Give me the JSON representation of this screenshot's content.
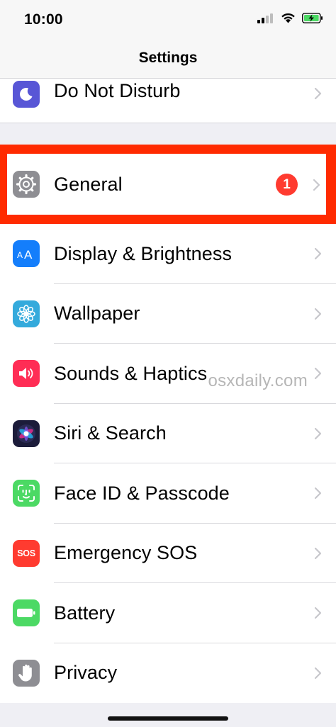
{
  "status": {
    "time": "10:00"
  },
  "nav": {
    "title": "Settings"
  },
  "rows": {
    "dnd": {
      "label": "Do Not Disturb",
      "icon": "moon-icon",
      "color": "#5856d6"
    },
    "general": {
      "label": "General",
      "icon": "gear-icon",
      "color": "#8e8e93",
      "badge": "1"
    },
    "display": {
      "label": "Display & Brightness",
      "icon": "text-size-icon",
      "color": "#147efb"
    },
    "wallpaper": {
      "label": "Wallpaper",
      "icon": "flower-icon",
      "color": "#34aadc"
    },
    "sounds": {
      "label": "Sounds & Haptics",
      "icon": "speaker-icon",
      "color": "#ff2d55"
    },
    "siri": {
      "label": "Siri & Search",
      "icon": "siri-icon",
      "color": "#1c1c3a"
    },
    "faceid": {
      "label": "Face ID & Passcode",
      "icon": "face-id-icon",
      "color": "#4cd964"
    },
    "sos": {
      "label": "Emergency SOS",
      "icon": "sos-icon",
      "color": "#ff3b30",
      "icon_text": "SOS"
    },
    "battery": {
      "label": "Battery",
      "icon": "battery-icon",
      "color": "#4cd964"
    },
    "privacy": {
      "label": "Privacy",
      "icon": "hand-icon",
      "color": "#8e8e93"
    }
  },
  "watermark": "osxdaily.com",
  "highlight_color": "#ff2a00"
}
